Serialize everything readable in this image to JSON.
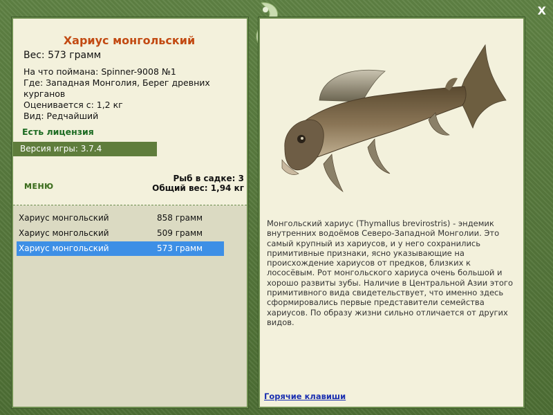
{
  "fish": {
    "title": "Хариус монгольский",
    "weight": "Вес: 573 грамм",
    "caught_with": "На что поймана: Spinner-9008 №1",
    "location_line1": "Где: Западная Монголия, Берег древних",
    "location_line2": "курганов",
    "value": "Оценивается с: 1,2 кг",
    "rarity": "Вид: Редчайший"
  },
  "license": "Есть лицензия",
  "version": "Версия игры: 3.7.4",
  "menu_label": "МЕНЮ",
  "keepnet": {
    "count": "Рыб в садке: 3",
    "total_weight": "Общий вес: 1,94 кг"
  },
  "catch_list": [
    {
      "name": "Хариус монгольский",
      "weight": "858 грамм",
      "selected": false
    },
    {
      "name": "Хариус монгольский",
      "weight": "509 грамм",
      "selected": false
    },
    {
      "name": "Хариус монгольский",
      "weight": "573 грамм",
      "selected": true
    }
  ],
  "description": "Монгольский хариус (Thymallus brevirostris) - эндемик внутренних водоёмов Северо-Западной Монголии. Это самый крупный из хариусов, и у него сохранились примитивные признаки, ясно указывающие на происхождение хариусов от предков, близких к лососёвым. Рот монгольского хариуса очень большой и хорошо развиты зубы. Наличие в Центральной Азии этого примитивного вида свидетельствует, что именно здесь сформировались первые представители семейства хариусов. По образу жизни сильно отличается от других видов.",
  "hotkeys_link": "Горячие клавиши",
  "close_label": "X",
  "colors": {
    "frame": "#5a7a3e",
    "panel": "#f3f1dc",
    "title": "#c24a12",
    "license": "#1c6b22",
    "selection": "#3d8fe6",
    "link": "#1a2fb0"
  }
}
